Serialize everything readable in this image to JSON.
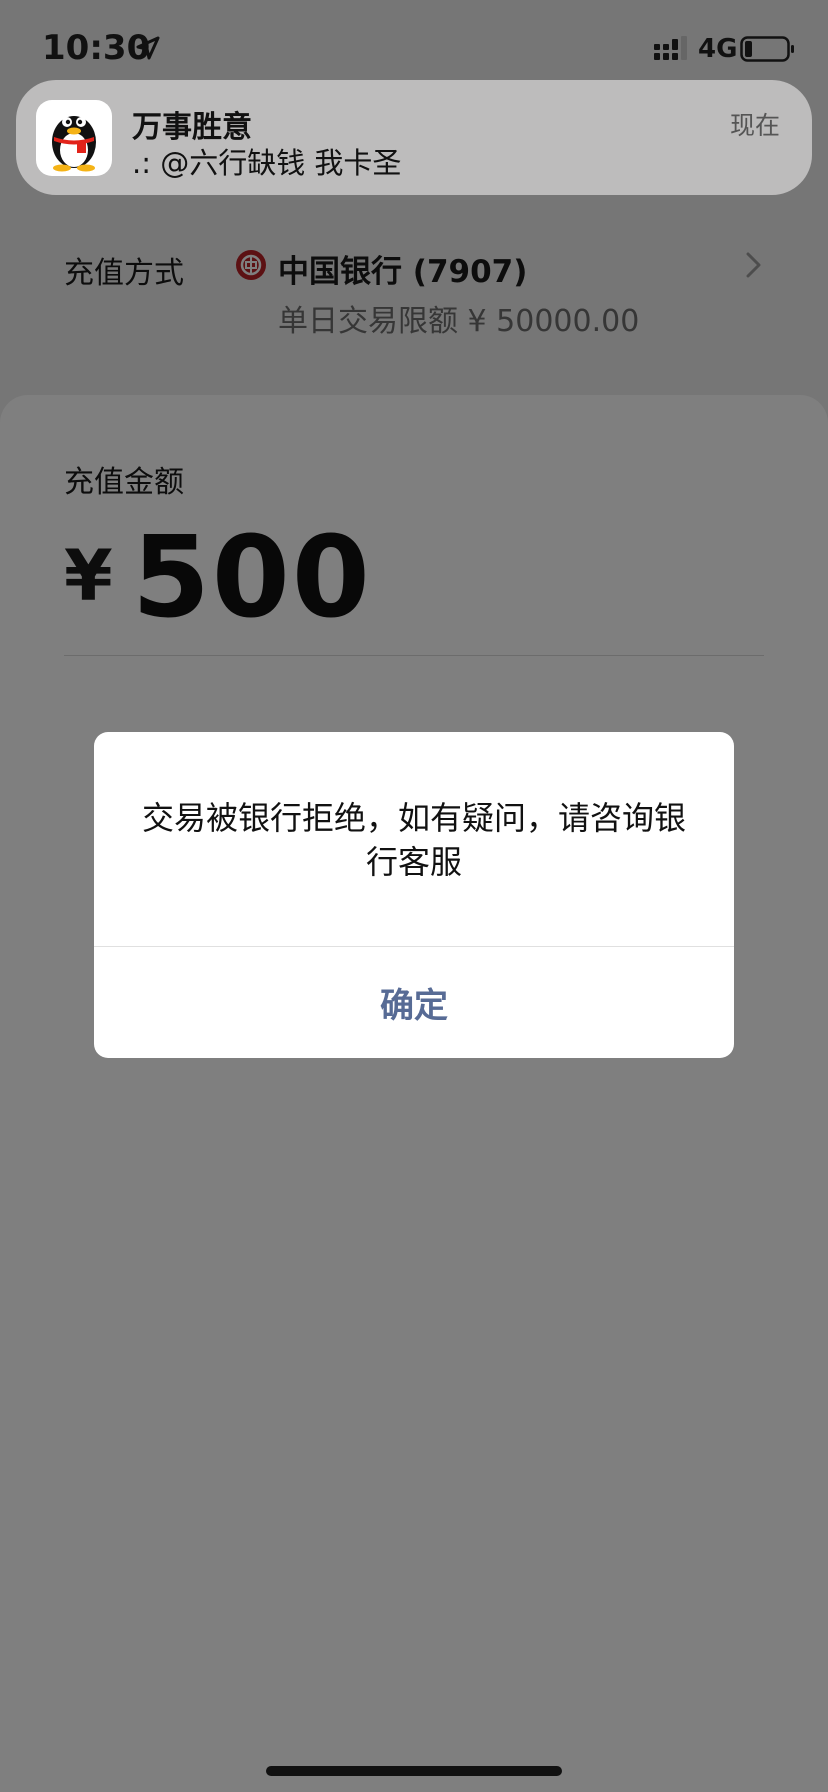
{
  "status_bar": {
    "time": "10:30",
    "network": "4G"
  },
  "notification": {
    "title": "万事胜意",
    "body": ".: @六行缺钱 我卡圣",
    "time": "现在",
    "app_icon": "qq-penguin-icon"
  },
  "recharge": {
    "method_label": "充值方式",
    "bank_name": "中国银行 (7907)",
    "bank_limit": "单日交易限额 ¥ 50000.00",
    "bank_icon": "bank-of-china-icon"
  },
  "amount": {
    "label": "充值金额",
    "currency": "¥",
    "value": "500"
  },
  "dialog": {
    "message": "交易被银行拒绝，如有疑问，请咨询银行客服",
    "confirm_label": "确定"
  },
  "colors": {
    "dialog_button": "#576b95",
    "bank_red": "#b92227"
  }
}
